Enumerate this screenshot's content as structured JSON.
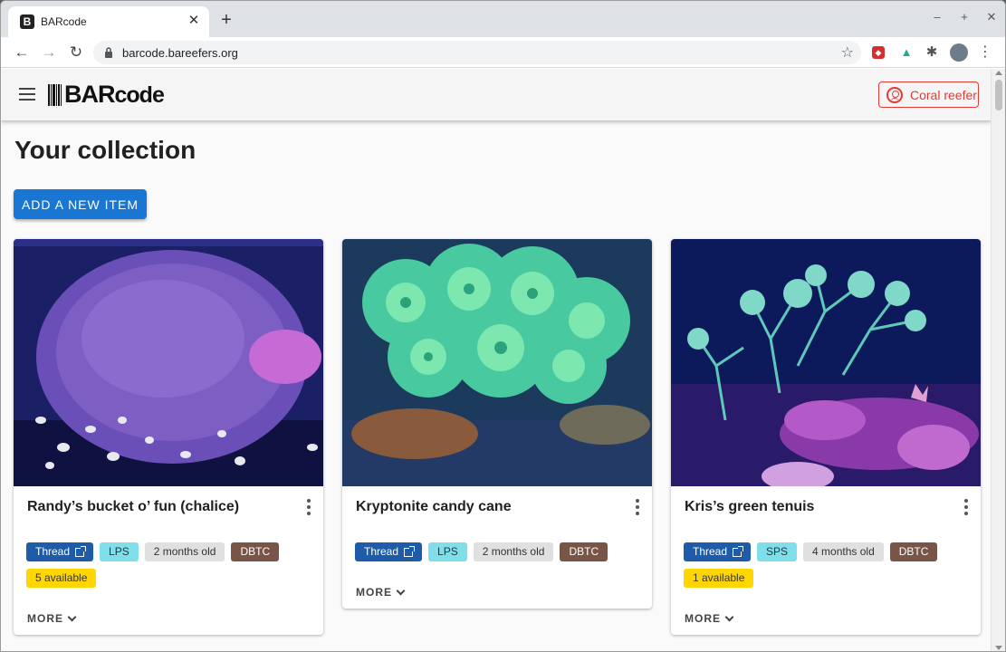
{
  "browser": {
    "tab_title": "BARcode",
    "tab_favicon": "B",
    "url": "barcode.bareefers.org",
    "window_controls": [
      "–",
      "+",
      "✕"
    ]
  },
  "app": {
    "logo": {
      "text": "BAR",
      "suffix": "code"
    },
    "profile_button": "Coral reefer"
  },
  "page": {
    "heading": "Your collection",
    "add_button": "ADD A NEW ITEM"
  },
  "cards": [
    {
      "title": "Randy’s bucket o’ fun (chalice)",
      "thread": "Thread",
      "category": "LPS",
      "age": "2 months old",
      "dbtc": "DBTC",
      "available": "5 available",
      "more": "MORE"
    },
    {
      "title": "Kryptonite candy cane",
      "thread": "Thread",
      "category": "LPS",
      "age": "2 months old",
      "dbtc": "DBTC",
      "more": "MORE"
    },
    {
      "title": "Kris’s green tenuis",
      "thread": "Thread",
      "category": "SPS",
      "age": "4 months old",
      "dbtc": "DBTC",
      "available": "1 available",
      "more": "MORE"
    }
  ],
  "colors": {
    "primary": "#1976d2",
    "accent_red": "#e53935",
    "thread_chip": "#1e5ba8",
    "category_chip": "#80deea",
    "dbtc_chip": "#795548",
    "available_chip": "#ffd600"
  }
}
